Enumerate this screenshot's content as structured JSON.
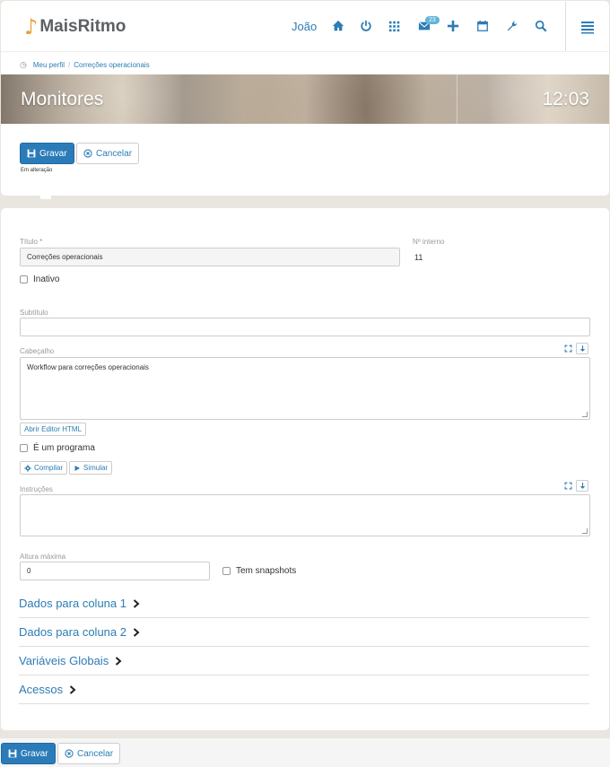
{
  "app": {
    "logo_text": "MaisRitmo",
    "logo_icon": "music-note-icon"
  },
  "header": {
    "user_name": "João",
    "icons": [
      "home-icon",
      "power-icon",
      "grid-icon",
      "mail-icon",
      "plus-icon",
      "calendar-icon",
      "wrench-icon",
      "search-icon",
      "menu-icon"
    ],
    "mail_badge": "23"
  },
  "breadcrumb": {
    "items": [
      "Meu perfil",
      "Correções operacionais"
    ]
  },
  "banner": {
    "title": "Monitores",
    "time": "12:03"
  },
  "actions": {
    "save_label": "Gravar",
    "cancel_label": "Cancelar",
    "status": "Em alteração"
  },
  "form": {
    "title_label": "Título *",
    "title_value": "Correções operacionais",
    "internal_label": "Nº interno",
    "internal_value": "11",
    "inactive_label": "Inativo",
    "subtitle_label": "Subtítulo",
    "subtitle_value": "",
    "header_label": "Cabeçalho",
    "header_value": "Workflow para correções operacionais",
    "html_editor_label": "Abrir Editor HTML",
    "is_program_label": "É um programa",
    "compile_label": "Compilar",
    "simulate_label": "Simular",
    "instructions_label": "Instruções",
    "instructions_value": "",
    "max_height_label": "Altura máxima",
    "max_height_value": "0",
    "snapshots_label": "Tem snapshots"
  },
  "sections": [
    "Dados para coluna 1",
    "Dados para coluna 2",
    "Variáveis Globais",
    "Acessos"
  ],
  "footer": {
    "save_label": "Gravar",
    "cancel_label": "Cancelar"
  },
  "colors": {
    "primary": "#2b7bb9",
    "link": "#2c7cb5",
    "logo_note": "#e8a23b",
    "badge": "#5fb4da"
  }
}
